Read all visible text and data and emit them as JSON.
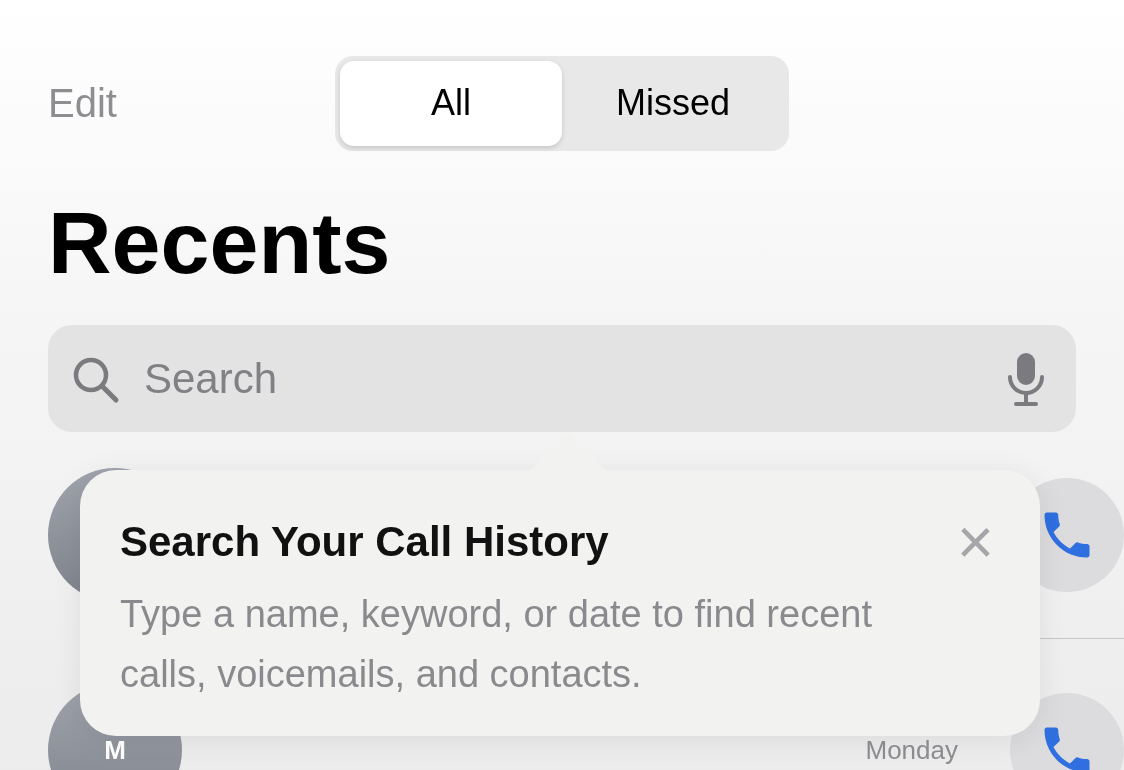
{
  "nav": {
    "edit": "Edit",
    "segments": [
      {
        "label": "All",
        "selected": true
      },
      {
        "label": "Missed",
        "selected": false
      }
    ]
  },
  "title": "Recents",
  "search": {
    "placeholder": "Search"
  },
  "calls": [
    {
      "kind": "person"
    },
    {
      "kind": "person",
      "initial": "M",
      "date": "Monday"
    }
  ],
  "tip": {
    "title": "Search Your Call History",
    "body": "Type a name, keyword, or date to find recent calls, voicemails, and contacts.",
    "close": "×"
  }
}
